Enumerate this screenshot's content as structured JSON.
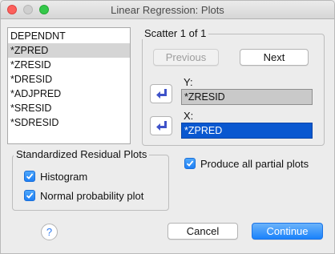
{
  "window": {
    "title": "Linear Regression: Plots"
  },
  "variables": [
    "DEPENDNT",
    "*ZPRED",
    "*ZRESID",
    "*DRESID",
    "*ADJPRED",
    "*SRESID",
    "*SDRESID"
  ],
  "scatter": {
    "legend": "Scatter 1 of 1",
    "previous_label": "Previous",
    "next_label": "Next",
    "y_label": "Y:",
    "y_value": "*ZRESID",
    "x_label": "X:",
    "x_value": "*ZPRED"
  },
  "residual_plots": {
    "legend": "Standardized Residual Plots",
    "histogram_label": "Histogram",
    "histogram_checked": true,
    "normal_plot_label": "Normal probability plot",
    "normal_plot_checked": true
  },
  "partial_plots": {
    "label": "Produce all partial plots",
    "checked": true
  },
  "footer": {
    "help_label": "?",
    "cancel_label": "Cancel",
    "continue_label": "Continue"
  },
  "colors": {
    "accent": "#1a82fb",
    "selection": "#0a58d0"
  }
}
